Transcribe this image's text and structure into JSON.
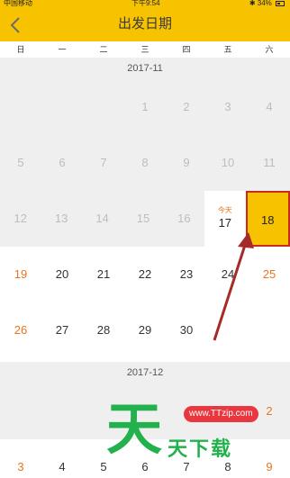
{
  "status_bar": {
    "carrier": "中国移动",
    "time": "下午9:54",
    "battery": "34%"
  },
  "header": {
    "title": "出发日期"
  },
  "weekdays": [
    "日",
    "一",
    "二",
    "三",
    "四",
    "五",
    "六"
  ],
  "months": [
    {
      "label": "2017-11",
      "rows": [
        [
          "",
          "",
          "",
          "1",
          "2",
          "3",
          "4"
        ],
        [
          "5",
          "6",
          "7",
          "8",
          "9",
          "10",
          "11"
        ],
        [
          "12",
          "13",
          "14",
          "15",
          "16",
          "17",
          "18"
        ],
        [
          "19",
          "20",
          "21",
          "22",
          "23",
          "24",
          "25"
        ],
        [
          "26",
          "27",
          "28",
          "29",
          "30",
          "",
          ""
        ]
      ]
    },
    {
      "label": "2017-12",
      "rows": [
        [
          "",
          "",
          "",
          "",
          "",
          "1",
          "2"
        ],
        [
          "3",
          "4",
          "5",
          "6",
          "7",
          "8",
          "9"
        ]
      ]
    }
  ],
  "today_label": "今天",
  "today_day": "17",
  "selected_day": "18",
  "watermark": {
    "big": "天",
    "url": "www.TTzip.com",
    "text": "天下载"
  },
  "colors": {
    "header_bg": "#f7c300",
    "weekend": "#e8761e",
    "past": "#bdbdbd",
    "selected_border": "#c72a1f",
    "arrow": "#a52a2a"
  }
}
